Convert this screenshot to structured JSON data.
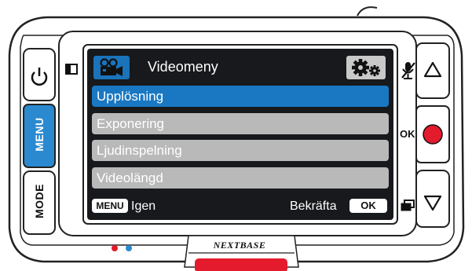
{
  "title": "Videomeny",
  "title_icon": "video-camera-icon",
  "settings_icon": "gear-icon",
  "menu": [
    {
      "label": "Upplösning",
      "selected": true
    },
    {
      "label": "Exponering",
      "selected": false
    },
    {
      "label": "Ljudinspelning",
      "selected": false
    },
    {
      "label": "Videolängd",
      "selected": false
    }
  ],
  "footer": {
    "menu_key": "MENU",
    "back_label": "Igen",
    "confirm_label": "Bekräfta",
    "ok_key": "OK"
  },
  "buttons": {
    "power_icon": "power-icon",
    "menu_label": "MENU",
    "mode_label": "MODE",
    "up_icon": "triangle-up-icon",
    "record_icon": "record-icon",
    "down_icon": "triangle-down-icon",
    "ok_label": "OK",
    "mic_icon": "microphone-muted-icon"
  },
  "brand": "NEXTBASE",
  "colors": {
    "menu_button": "#2b89d0",
    "selected_item": "#1a78c2",
    "record": "#e41b2c",
    "bottom_tab": "#e41b2c",
    "led_red": "#e41b2c",
    "led_blue": "#2b89d0"
  }
}
